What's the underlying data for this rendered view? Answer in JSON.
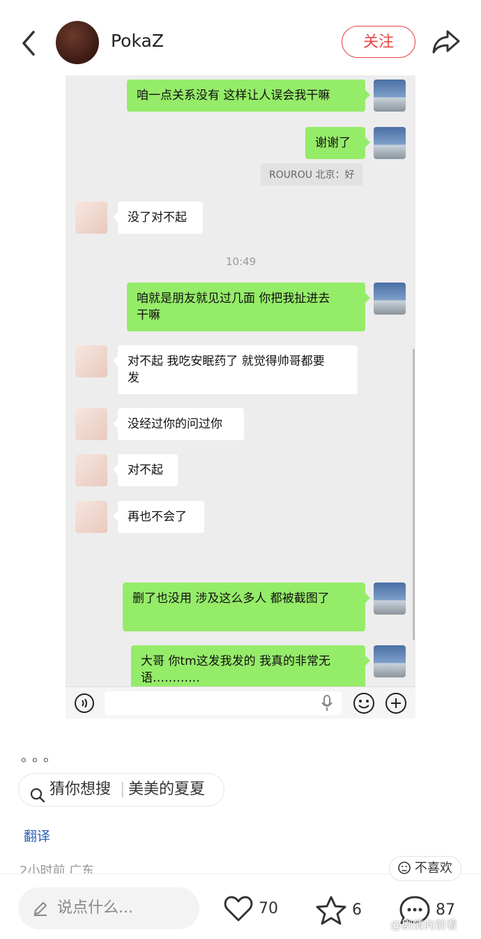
{
  "header": {
    "username": "PokaZ",
    "follow_label": "关注"
  },
  "chat": {
    "messages": {
      "m1": "咱一点关系没有 这样让人误会我干嘛",
      "m2": "谢谢了",
      "quote": "ROUROU 北京：好",
      "m3": "没了对不起",
      "time": "10:49",
      "m4a": "咱就是朋友就见过几面 你把我扯进去",
      "m4b": "干嘛",
      "m5a": "对不起 我吃安眠药了 就觉得帅哥都要",
      "m5b": "发",
      "m6": "没经过你的问过你",
      "m7": "对不起",
      "m8": "再也不会了",
      "m9": "删了也没用 涉及这么多人 都被截图了",
      "m10a": "大哥 你tm这发我发的 我真的非常无",
      "m10b": "语…………"
    }
  },
  "post": {
    "more": "。。。",
    "guess_label": "猜你想搜",
    "guess_term": "美美的夏夏",
    "translate": "翻译",
    "meta": "2小时前 广东",
    "dislike": "不喜欢"
  },
  "bottom_bar": {
    "comment_placeholder": "说点什么...",
    "likes": "70",
    "stars": "6",
    "comments": "87"
  },
  "watermark": "@剧情向前看",
  "colors": {
    "accent": "#e84545",
    "wechat_green": "#95ec69",
    "link": "#2b5fb4"
  },
  "icons": [
    "back-arrow-icon",
    "share-icon",
    "voice-icon",
    "mic-icon",
    "emoji-icon",
    "plus-icon",
    "search-icon",
    "pen-icon",
    "heart-icon",
    "star-icon",
    "comment-icon",
    "dislike-icon"
  ]
}
